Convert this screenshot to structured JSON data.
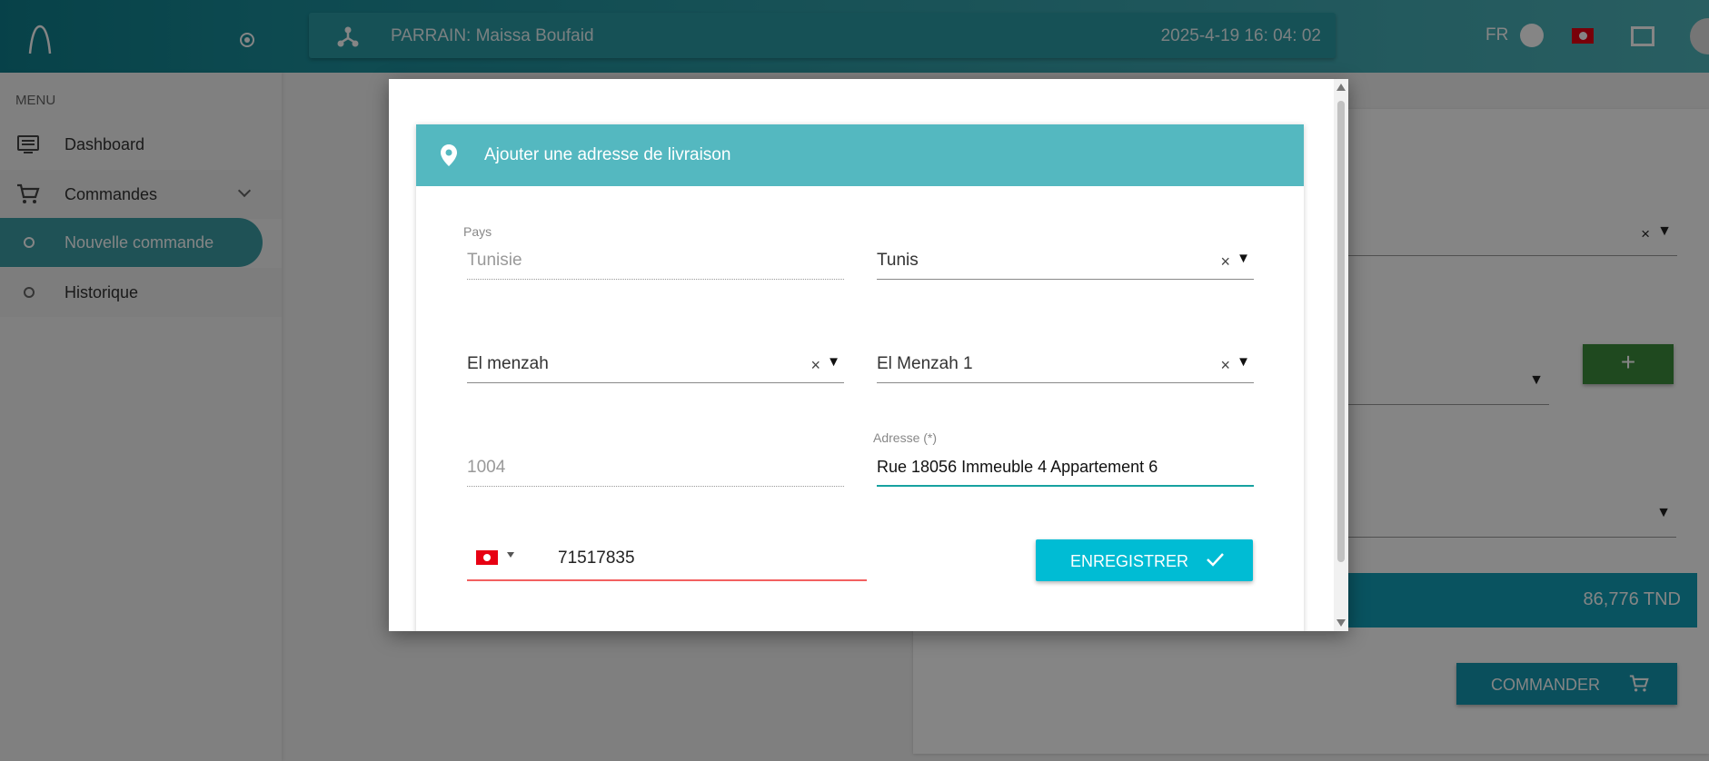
{
  "header": {
    "parrain": "PARRAIN: Maissa Boufaid",
    "datetime": "2025-4-19 16: 04: 02",
    "language": "FR"
  },
  "sidebar": {
    "menu_label": "MENU",
    "items": [
      {
        "label": "Dashboard",
        "icon": "dashboard-icon"
      },
      {
        "label": "Commandes",
        "icon": "cart-icon"
      },
      {
        "label": "Nouvelle commande",
        "icon": "bullet-icon",
        "active": true
      },
      {
        "label": "Historique",
        "icon": "bullet-icon"
      }
    ]
  },
  "background": {
    "add_button": "+",
    "total": "86,776 TND",
    "order_button": "COMMANDER"
  },
  "modal": {
    "title": "Ajouter une adresse de livraison",
    "fields": {
      "country_label": "Pays",
      "country_value": "Tunisie",
      "governorate_value": "Tunis",
      "delegation_value": "El menzah",
      "locality_value": "El Menzah 1",
      "postal_code_value": "1004",
      "address_label": "Adresse (*)",
      "address_value": "Rue 18056 Immeuble 4  Appartement 6",
      "phone_value": "71517835"
    },
    "clear_symbol": "×",
    "dropdown_symbol": "▼",
    "save_label": "ENREGISTRER"
  },
  "colors": {
    "primary": "#1a8e9a",
    "modal_header": "#54b8c0",
    "save_button": "#00bcd4",
    "add_button": "#3c8c3c",
    "total_bar": "#12a0b8",
    "error": "#f26060",
    "focus": "#17a2a0"
  }
}
